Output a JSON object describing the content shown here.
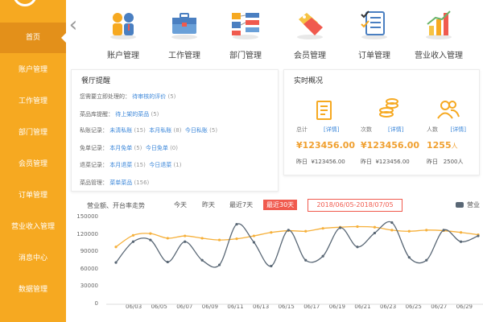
{
  "sidebar": {
    "items": [
      {
        "label": "首页",
        "active": true
      },
      {
        "label": "账户管理"
      },
      {
        "label": "工作管理"
      },
      {
        "label": "部门管理"
      },
      {
        "label": "会员管理"
      },
      {
        "label": "订单管理"
      },
      {
        "label": "营业收入管理"
      },
      {
        "label": "消息中心"
      },
      {
        "label": "数据管理"
      }
    ]
  },
  "modules": [
    {
      "label": "账户管理",
      "icon": "account-icon"
    },
    {
      "label": "工作管理",
      "icon": "briefcase-icon"
    },
    {
      "label": "部门管理",
      "icon": "org-chart-icon"
    },
    {
      "label": "会员管理",
      "icon": "tags-icon"
    },
    {
      "label": "订单管理",
      "icon": "checklist-icon"
    },
    {
      "label": "营业收入管理",
      "icon": "bar-chart-icon"
    }
  ],
  "reminders": {
    "title": "餐厅提醒",
    "rows": [
      {
        "label": "您需要立即处理的",
        "links": [
          {
            "text": "待审核的评价",
            "count": "(5)"
          }
        ]
      },
      {
        "label": "菜品库提醒",
        "links": [
          {
            "text": "待上架的菜品",
            "count": "(5)"
          }
        ]
      },
      {
        "label": "私账记录",
        "links": [
          {
            "text": "未清私账",
            "count": "(15)"
          },
          {
            "text": "本月私账",
            "count": "(8)"
          },
          {
            "text": "今日私账",
            "count": "(5)"
          }
        ]
      },
      {
        "label": "免单记录",
        "links": [
          {
            "text": "本月免单",
            "count": "(5)"
          },
          {
            "text": "今日免单",
            "count": "(0)"
          }
        ]
      },
      {
        "label": "退菜记录",
        "links": [
          {
            "text": "本月退菜",
            "count": "(15)"
          },
          {
            "text": "今日退菜",
            "count": "(1)"
          }
        ]
      },
      {
        "label": "菜品管理",
        "links": [
          {
            "text": "菜单菜品",
            "count": "(156)"
          }
        ]
      }
    ]
  },
  "overview": {
    "title": "实时概况",
    "detail_label": "[详情]",
    "yesterday_label": "昨日",
    "stats": [
      {
        "label": "总计",
        "value": "¥123456.00",
        "unit": "",
        "yesterday": "¥123456.00",
        "icon": "document-icon"
      },
      {
        "label": "次数",
        "value": "¥123456.00",
        "unit": "",
        "yesterday": "¥123456.00",
        "icon": "coins-icon"
      },
      {
        "label": "人数",
        "value": "1255",
        "unit": "人",
        "yesterday": "2500人",
        "icon": "people-icon"
      }
    ]
  },
  "chart": {
    "heading": "营业额、开台率走势",
    "tabs": [
      {
        "label": "今天"
      },
      {
        "label": "昨天"
      },
      {
        "label": "最近7天"
      },
      {
        "label": "最近30天",
        "active": true
      }
    ],
    "date_range": "2018/06/05-2018/07/05",
    "legend_label": "营业"
  },
  "colors": {
    "accent": "#f6a921",
    "accent_dark": "#e3901a",
    "series_dark": "#596775",
    "series_orange": "#f6b03a",
    "active_tab": "#f05a4e",
    "link": "#3a86d9"
  },
  "chart_data": {
    "type": "line",
    "title": "营业额、开台率走势",
    "categories": [
      "06/03",
      "06/05",
      "06/07",
      "06/09",
      "06/11",
      "06/13",
      "06/15",
      "06/17",
      "06/19",
      "06/21",
      "06/23",
      "06/25",
      "06/27",
      "06/29"
    ],
    "ylim": [
      0,
      150000
    ],
    "yticks": [
      "150000",
      "120000",
      "90000",
      "60000",
      "30000",
      "0"
    ],
    "series": [
      {
        "name": "营业",
        "color": "#596775",
        "values": [
          72000,
          108000,
          111000,
          73000,
          108000,
          76000,
          68000,
          138000,
          107000,
          66000,
          128000,
          76000,
          83000,
          132000,
          99000,
          123000,
          141000,
          81000,
          76000,
          128000,
          108000,
          118000
        ]
      },
      {
        "name": "",
        "color": "#f6b03a",
        "values": [
          99000,
          119000,
          122000,
          114000,
          118000,
          114000,
          111000,
          113000,
          118000,
          124000,
          127000,
          126000,
          131000,
          133000,
          134000,
          133000,
          128000,
          126000,
          128000,
          127000,
          124000,
          120000
        ]
      }
    ]
  }
}
